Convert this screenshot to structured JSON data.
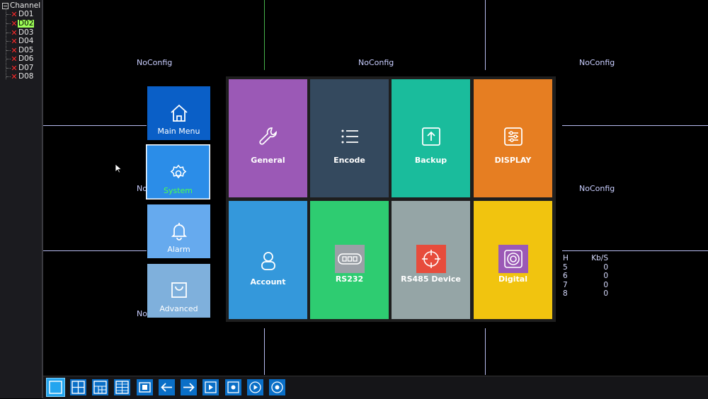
{
  "sidebar": {
    "title": "Channel",
    "channels": [
      "D01",
      "D02",
      "D03",
      "D04",
      "D05",
      "D06",
      "D07",
      "D08"
    ],
    "selected": "D02"
  },
  "video": {
    "no_config": [
      "NoConfig",
      "NoConfig",
      "NoConfig",
      "No",
      "NoConfig",
      "No"
    ],
    "stats": {
      "ch_header": "H",
      "kbs_header": "Kb/S",
      "rows": [
        {
          "ch": "5",
          "kbs": "0"
        },
        {
          "ch": "6",
          "kbs": "0"
        },
        {
          "ch": "7",
          "kbs": "0"
        },
        {
          "ch": "8",
          "kbs": "0"
        }
      ]
    }
  },
  "menu": {
    "tabs": [
      {
        "label": "Main Menu",
        "icon": "home-icon",
        "color": "#0a5fc7"
      },
      {
        "label": "System",
        "icon": "gear-icon",
        "color": "#2b8de8",
        "active": true,
        "active_color": "#4dff4d"
      },
      {
        "label": "Alarm",
        "icon": "bell-icon",
        "color": "#66aaee"
      },
      {
        "label": "Advanced",
        "icon": "bag-icon",
        "color": "#7fb0dc"
      }
    ],
    "tiles": [
      {
        "label": "General",
        "icon": "wrench-icon",
        "color": "#9b59b6"
      },
      {
        "label": "Encode",
        "icon": "list-icon",
        "color": "#34495e"
      },
      {
        "label": "Backup",
        "icon": "upload-icon",
        "color": "#1abc9c"
      },
      {
        "label": "DISPLAY",
        "icon": "sliders-icon",
        "color": "#e67e22"
      },
      {
        "label": "Account",
        "icon": "user-icon",
        "color": "#3498db"
      },
      {
        "label": "RS232",
        "icon": "serial-port-icon",
        "color": "#2ecc71",
        "badge": "#9aa0a6"
      },
      {
        "label": "RS485 Device",
        "icon": "crosshair-icon",
        "color": "#95a5a6",
        "badge": "#e74c3c"
      },
      {
        "label": "Digital",
        "icon": "target-icon",
        "color": "#f1c40f",
        "badge": "#9b59b6"
      }
    ]
  },
  "toolbar": {
    "buttons": [
      "single-view-icon",
      "quad-view-icon",
      "nine-view-icon",
      "sixteen-view-icon",
      "fullscreen-icon",
      "prev-arrow-icon",
      "next-arrow-icon",
      "playback-icon",
      "record-icon",
      "play-icon",
      "stop-icon"
    ]
  }
}
